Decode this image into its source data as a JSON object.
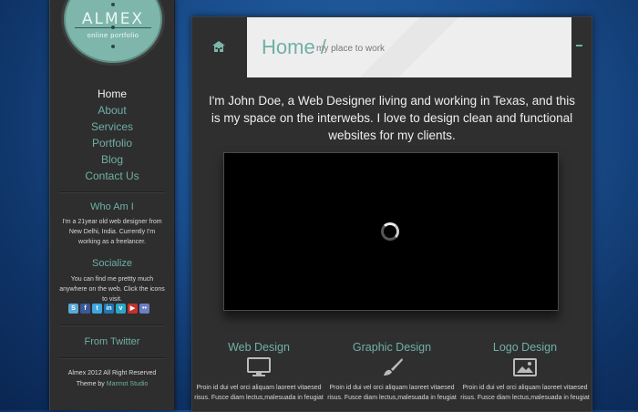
{
  "logo": {
    "title": "ALMEX",
    "subtitle": "online portfolio"
  },
  "nav": {
    "items": [
      {
        "label": "Home",
        "active": true
      },
      {
        "label": "About",
        "active": false
      },
      {
        "label": "Services",
        "active": false
      },
      {
        "label": "Portfolio",
        "active": false
      },
      {
        "label": "Blog",
        "active": false
      },
      {
        "label": "Contact Us",
        "active": false
      }
    ]
  },
  "who": {
    "heading": "Who Am I",
    "text": "I'm a 21year old web designer from New Delhi, India. Currently I'm working as a freelancer."
  },
  "socialize": {
    "heading": "Socialize",
    "text": "You can find me prettty much anywhere on the web. Click the icons to visit.",
    "icons": [
      {
        "name": "skype-icon",
        "glyph": "S",
        "color": "#5aa9d8"
      },
      {
        "name": "facebook-icon",
        "glyph": "f",
        "color": "#3b5998"
      },
      {
        "name": "twitter-icon",
        "glyph": "t",
        "color": "#3ea7e0"
      },
      {
        "name": "linkedin-icon",
        "glyph": "in",
        "color": "#1e76b3"
      },
      {
        "name": "vimeo-icon",
        "glyph": "v",
        "color": "#2ba6c9"
      },
      {
        "name": "youtube-icon",
        "glyph": "▶",
        "color": "#c4302b"
      },
      {
        "name": "flickr-icon",
        "glyph": "••",
        "color": "#6d7ec5"
      }
    ]
  },
  "twitter": {
    "heading": "From Twitter"
  },
  "footer": {
    "copyright": "Almex 2012 All Right Reserved",
    "theme_prefix": "Theme by",
    "theme_link": "Marmot Studio"
  },
  "header": {
    "title": "Home /",
    "subtitle": "my place to work"
  },
  "intro": "I'm John Doe, a Web Designer living and working in Texas, and this is my space on the interwebs. I love to design clean and functional websites for my clients.",
  "services": [
    {
      "title": "Web Design",
      "icon": "monitor-icon",
      "text": "Proin id dui vel orci aliquam laoreet vitaesed risus. Fusce diam lectus,malesuada in feugiat"
    },
    {
      "title": "Graphic Design",
      "icon": "brush-icon",
      "text": "Proin id dui vel orci aliquam laoreet vitaesed risus. Fusce diam lectus,malesuada in feugiat"
    },
    {
      "title": "Logo Design",
      "icon": "image-icon",
      "text": "Proin id dui vel orci aliquam laoreet vitaesed risus. Fusce diam lectus,malesuada in feugiat"
    }
  ],
  "colors": {
    "accent": "#6fb0a4",
    "panel": "#2f2f2f",
    "background": "#1a4f8f"
  }
}
